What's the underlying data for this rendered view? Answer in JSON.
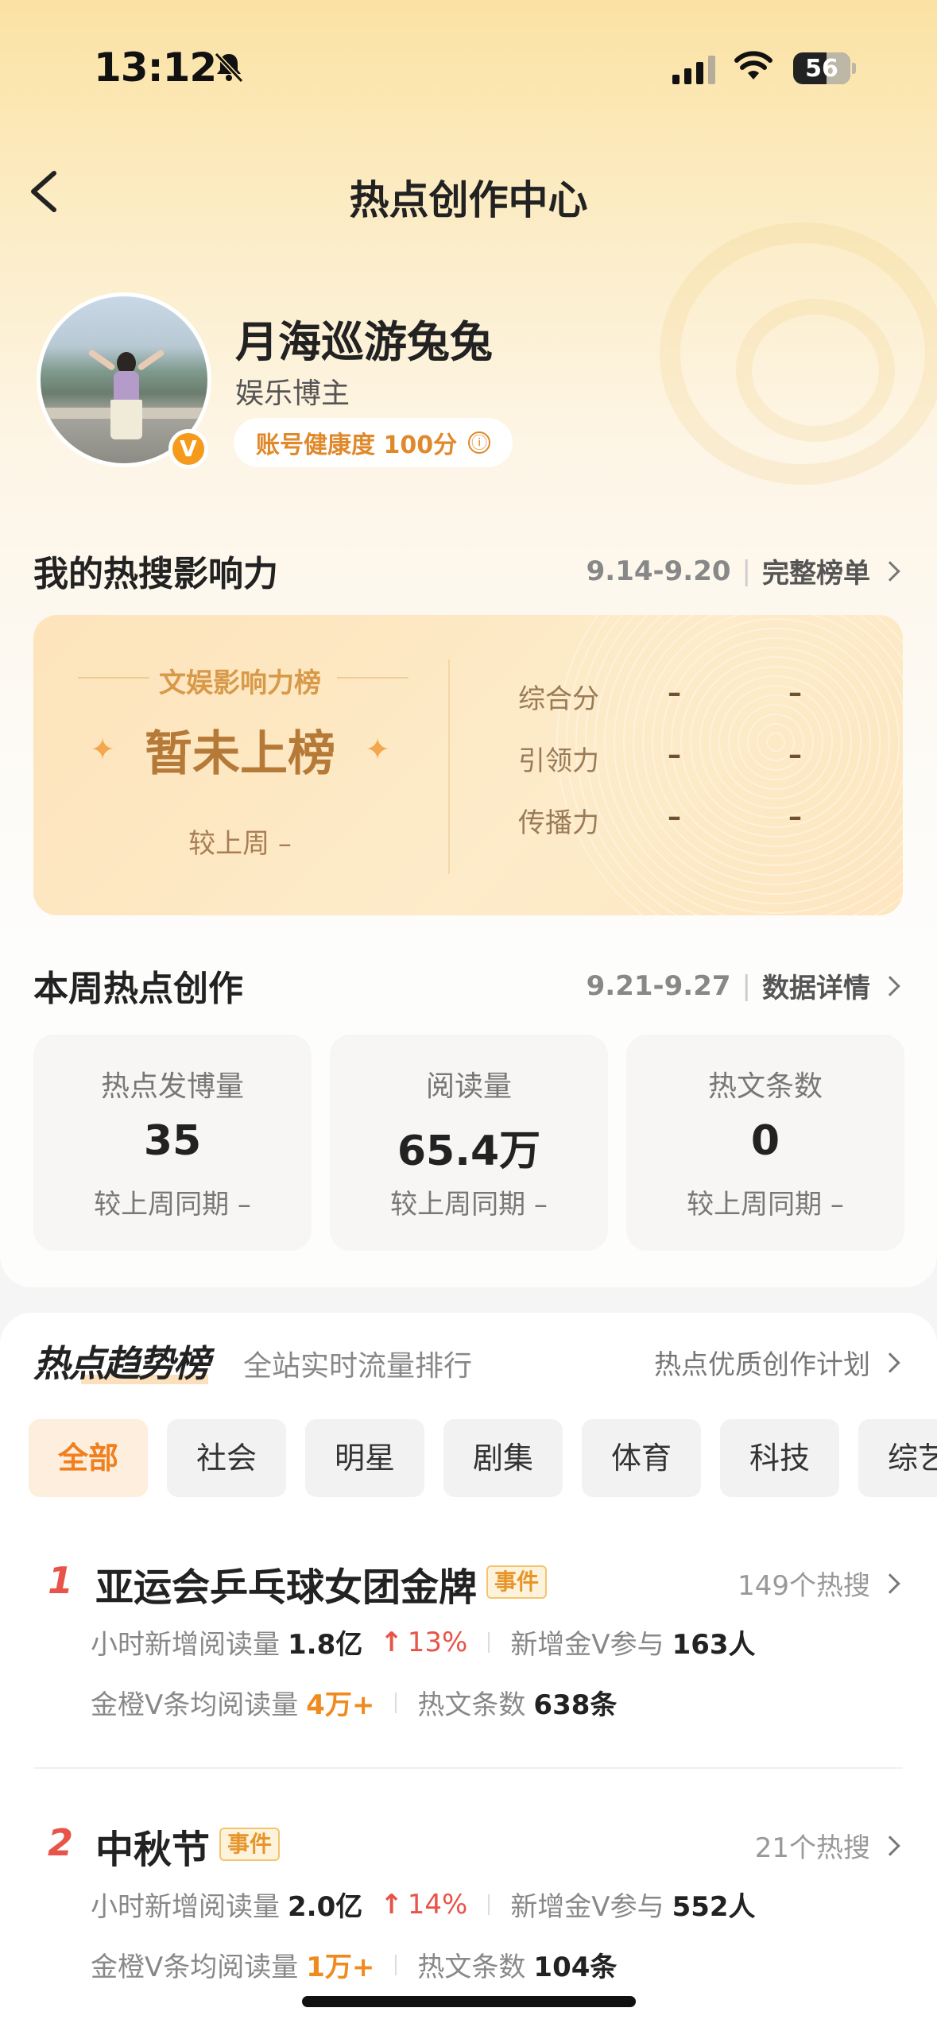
{
  "status_bar": {
    "time": "13:12",
    "battery": "56"
  },
  "nav": {
    "title": "热点创作中心"
  },
  "profile": {
    "name": "月海巡游兔兔",
    "role": "娱乐博主",
    "verified_badge": "V",
    "health_label": "账号健康度 100分",
    "info_icon": "ⓘ"
  },
  "influence": {
    "title": "我的热搜影响力",
    "date_range": "9.14-9.20",
    "link": "完整榜单",
    "rank_label": "文娱影响力榜",
    "rank_status": "暂未上榜",
    "compare": "较上周 –",
    "metrics": [
      {
        "label": "综合分",
        "v1": "–",
        "v2": "–"
      },
      {
        "label": "引领力",
        "v1": "–",
        "v2": "–"
      },
      {
        "label": "传播力",
        "v1": "–",
        "v2": "–"
      }
    ]
  },
  "weekly": {
    "title": "本周热点创作",
    "date_range": "9.21-9.27",
    "link": "数据详情",
    "stats": [
      {
        "label": "热点发博量",
        "value": "35",
        "compare": "较上周同期 –"
      },
      {
        "label": "阅读量",
        "value": "65.4万",
        "compare": "较上周同期 –"
      },
      {
        "label": "热文条数",
        "value": "0",
        "compare": "较上周同期 –"
      }
    ]
  },
  "trends": {
    "title": "热点趋势榜",
    "subtitle": "全站实时流量排行",
    "link": "热点优质创作计划",
    "tabs": [
      "全部",
      "社会",
      "明星",
      "剧集",
      "体育",
      "科技",
      "综艺"
    ],
    "active_tab": 0,
    "items": [
      {
        "rank": "1",
        "title": "亚运会乒乓球女团金牌",
        "tag": "事件",
        "count": "149个热搜",
        "hourly_label": "小时新增阅读量",
        "hourly_value": "1.8亿",
        "growth": "13%",
        "gold_v_label": "新增金V参与",
        "gold_v_value": "163人",
        "avg_label": "金橙V条均阅读量",
        "avg_value": "4万+",
        "hot_label": "热文条数",
        "hot_value": "638条"
      },
      {
        "rank": "2",
        "title": "中秋节",
        "tag": "事件",
        "count": "21个热搜",
        "hourly_label": "小时新增阅读量",
        "hourly_value": "2.0亿",
        "growth": "14%",
        "gold_v_label": "新增金V参与",
        "gold_v_value": "552人",
        "avg_label": "金橙V条均阅读量",
        "avg_value": "1万+",
        "hot_label": "热文条数",
        "hot_value": "104条"
      }
    ]
  }
}
